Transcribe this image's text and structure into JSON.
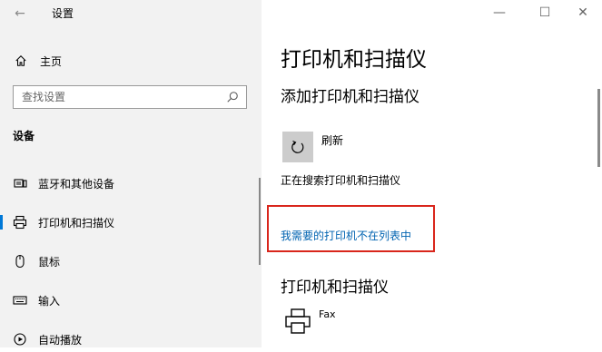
{
  "window": {
    "title": "设置",
    "controls": {
      "minimize": "—",
      "maximize": "☐",
      "close": "✕"
    }
  },
  "sidebar": {
    "home_label": "主页",
    "search_placeholder": "查找设置",
    "section_title": "设备",
    "items": [
      {
        "label": "蓝牙和其他设备",
        "icon": "bluetooth-device-icon",
        "selected": false
      },
      {
        "label": "打印机和扫描仪",
        "icon": "printer-icon",
        "selected": true
      },
      {
        "label": "鼠标",
        "icon": "mouse-icon",
        "selected": false
      },
      {
        "label": "输入",
        "icon": "keyboard-icon",
        "selected": false
      },
      {
        "label": "自动播放",
        "icon": "autoplay-icon",
        "selected": false
      }
    ]
  },
  "main": {
    "page_title": "打印机和扫描仪",
    "add_section_title": "添加打印机和扫描仪",
    "refresh_label": "刷新",
    "searching_text": "正在搜索打印机和扫描仪",
    "not_listed_link": "我需要的打印机不在列表中",
    "printers_section_title": "打印机和扫描仪",
    "printers": [
      {
        "name": "Fax"
      }
    ]
  },
  "colors": {
    "sidebar_bg": "#f2f2f2",
    "accent": "#0078d7",
    "link": "#0063b1",
    "highlight_border": "#d9261c"
  }
}
